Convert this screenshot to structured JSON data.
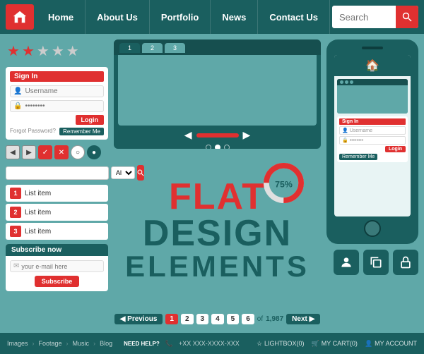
{
  "navbar": {
    "logo_alt": "Home Logo",
    "items": [
      {
        "label": "Home",
        "id": "home"
      },
      {
        "label": "About Us",
        "id": "about"
      },
      {
        "label": "Portfolio",
        "id": "portfolio"
      },
      {
        "label": "News",
        "id": "news"
      },
      {
        "label": "Contact Us",
        "id": "contact"
      }
    ],
    "search_placeholder": "Search"
  },
  "stars": {
    "filled": 2,
    "outline": 3,
    "symbol_filled": "★",
    "symbol_outline": "★"
  },
  "login": {
    "title": "Sign In",
    "username_placeholder": "Username",
    "password_placeholder": "••••••••",
    "login_btn": "Login",
    "forgot_label": "Forgot Password?",
    "remember_btn": "Remember Me"
  },
  "nav_controls": {
    "prev": "◀",
    "next": "▶",
    "check": "✓",
    "cross": "✕",
    "radio": "○",
    "circle_fill": "●"
  },
  "search_bar": {
    "placeholder": "",
    "all_option": "All"
  },
  "list_items": [
    {
      "num": "1",
      "label": "List item"
    },
    {
      "num": "2",
      "label": "List item"
    },
    {
      "num": "3",
      "label": "List item"
    }
  ],
  "subscribe": {
    "title": "Subscribe now",
    "email_placeholder": "your e-mail here",
    "btn_label": "Subscribe"
  },
  "browser": {
    "tabs": [
      {
        "label": "1",
        "active": false
      },
      {
        "label": "2",
        "active": false
      },
      {
        "label": "3",
        "active": false
      }
    ]
  },
  "flat_design": {
    "line1": "FLAT",
    "line2": "DESIGN",
    "line3": "ELEMENTS"
  },
  "donut": {
    "percentage": 75,
    "label": "75%"
  },
  "pagination": {
    "prev_label": "◀ Previous",
    "next_label": "Next ▶",
    "pages": [
      "1",
      "2",
      "3",
      "4",
      "5",
      "6"
    ],
    "active_page": "1",
    "of_label": "of",
    "total": "1,987"
  },
  "phone": {
    "login_title": "Sign In",
    "username_placeholder": "Username",
    "password_placeholder": "••••••••",
    "login_btn": "Login",
    "remember_btn": "Remember Me"
  },
  "icons": {
    "user": "👤",
    "copy": "⧉",
    "lock": "🔒"
  },
  "bottom_bar": {
    "links": [
      "Images",
      "Footage",
      "Music",
      "Blog"
    ],
    "need_help": "NEED HELP?",
    "phone": "+XX XXX-XXXX-XXX",
    "lightbox": "LIGHTBOX(0)",
    "cart": "MY CART(0)",
    "account": "MY ACCOUNT"
  }
}
